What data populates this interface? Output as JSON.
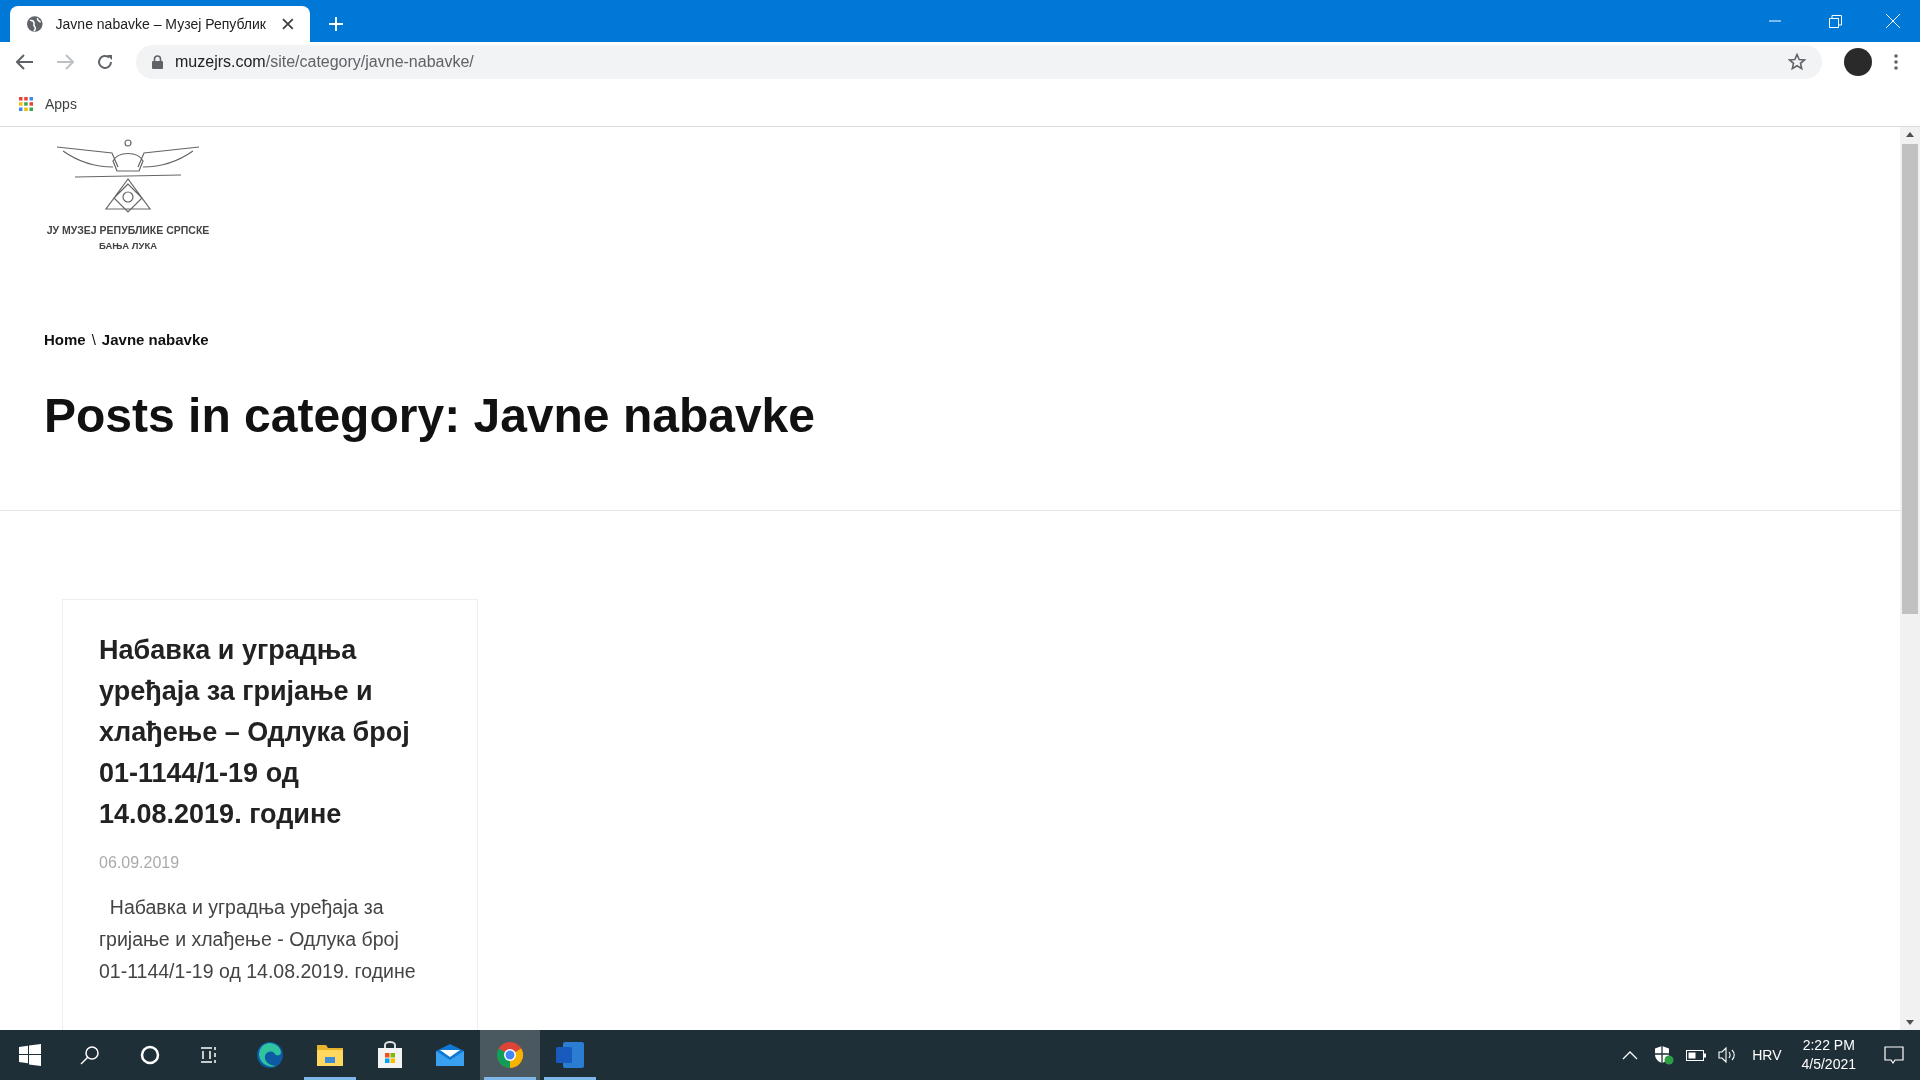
{
  "browser": {
    "tab_title": "Javne nabavke – Музеј Републик",
    "url_host": "muzejrs.com",
    "url_path": "/site/category/javne-nabavke/",
    "bookmarks": [
      "Apps"
    ]
  },
  "site": {
    "logo_lines": [
      "ЈУ МУЗЕЈ РЕПУБЛИКЕ СРПСКЕ",
      "БАЊА ЛУКА"
    ],
    "breadcrumb": [
      {
        "label": "Home"
      },
      {
        "label": "Javne nabavke"
      }
    ],
    "breadcrumb_separator": "\\",
    "heading": "Posts in category: Javne nabavke",
    "posts": [
      {
        "title": "Набавка и уградња уређаја за гријање и хлађење – Одлука број 01-1144/1-19 од 14.08.2019. године",
        "date": "06.09.2019",
        "excerpt": "  Набавка и уградња уређаја за гријање и хлађење - Одлука број 01-1144/1-19 од 14.08.2019. године"
      }
    ]
  },
  "taskbar": {
    "apps": [
      {
        "kind": "start",
        "running": false,
        "selected": false
      },
      {
        "kind": "search",
        "running": false,
        "selected": false
      },
      {
        "kind": "cortana",
        "running": false,
        "selected": false
      },
      {
        "kind": "taskview",
        "running": false,
        "selected": false
      },
      {
        "kind": "edge",
        "running": false,
        "selected": false
      },
      {
        "kind": "explorer",
        "running": true,
        "selected": false
      },
      {
        "kind": "store",
        "running": false,
        "selected": false
      },
      {
        "kind": "mail",
        "running": false,
        "selected": false
      },
      {
        "kind": "chrome",
        "running": true,
        "selected": true
      },
      {
        "kind": "word",
        "running": true,
        "selected": false
      }
    ],
    "language": "HRV",
    "time": "2:22 PM",
    "date": "4/5/2021"
  }
}
